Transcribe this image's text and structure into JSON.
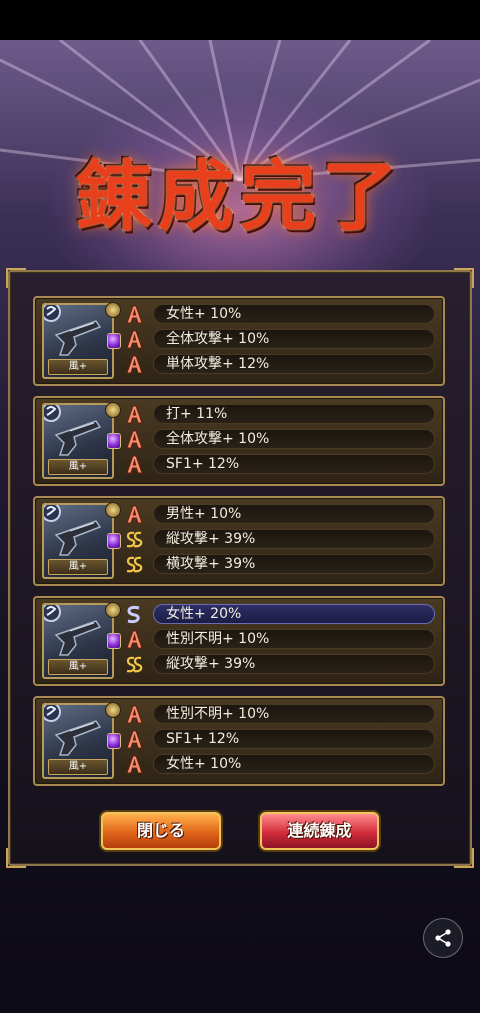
{
  "title": "錬成完了",
  "buttons": {
    "close_label": "閉じる",
    "continue_label": "連続錬成"
  },
  "icons": {
    "share": "share-icon"
  },
  "colors": {
    "accent_gold": "#c9a45a",
    "title_red": "#e8401c",
    "highlight_blue": "#2d2f66"
  },
  "results": [
    {
      "weapon_icon": "pistol-icon",
      "element_label": "風+",
      "stats": [
        {
          "rank": "A",
          "text": "女性+ 10%",
          "highlight": false
        },
        {
          "rank": "A",
          "text": "全体攻撃+ 10%",
          "highlight": false
        },
        {
          "rank": "A",
          "text": "単体攻撃+ 12%",
          "highlight": false
        }
      ]
    },
    {
      "weapon_icon": "pistol-icon",
      "element_label": "風+",
      "stats": [
        {
          "rank": "A",
          "text": "打+ 11%",
          "highlight": false
        },
        {
          "rank": "A",
          "text": "全体攻撃+ 10%",
          "highlight": false
        },
        {
          "rank": "A",
          "text": "SF1+ 12%",
          "highlight": false
        }
      ]
    },
    {
      "weapon_icon": "pistol-icon",
      "element_label": "風+",
      "stats": [
        {
          "rank": "A",
          "text": "男性+ 10%",
          "highlight": false
        },
        {
          "rank": "SS",
          "text": "縦攻撃+ 39%",
          "highlight": false
        },
        {
          "rank": "SS",
          "text": "横攻撃+ 39%",
          "highlight": false
        }
      ]
    },
    {
      "weapon_icon": "pistol-icon",
      "element_label": "風+",
      "stats": [
        {
          "rank": "S",
          "text": "女性+ 20%",
          "highlight": true
        },
        {
          "rank": "A",
          "text": "性別不明+ 10%",
          "highlight": false
        },
        {
          "rank": "SS",
          "text": "縦攻撃+ 39%",
          "highlight": false
        }
      ]
    },
    {
      "weapon_icon": "pistol-icon",
      "element_label": "風+",
      "stats": [
        {
          "rank": "A",
          "text": "性別不明+ 10%",
          "highlight": false
        },
        {
          "rank": "A",
          "text": "SF1+ 12%",
          "highlight": false
        },
        {
          "rank": "A",
          "text": "女性+ 10%",
          "highlight": false
        }
      ]
    }
  ]
}
